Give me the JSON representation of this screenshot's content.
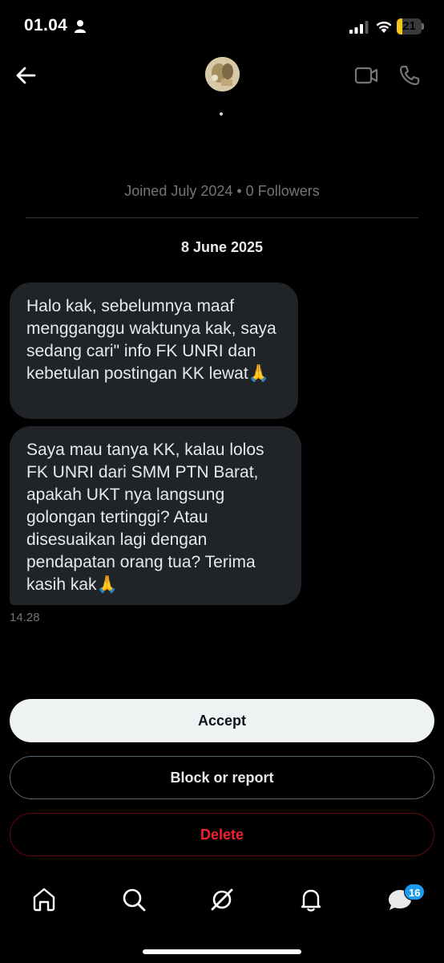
{
  "status_bar": {
    "time": "01.04",
    "battery_level": "21",
    "battery_fraction": 0.21
  },
  "header": {
    "back_icon": "arrow-left-icon",
    "avatar": "avatar",
    "video_icon": "video-camera-icon",
    "phone_icon": "phone-icon"
  },
  "profile": {
    "meta": "Joined July 2024 • 0 Followers"
  },
  "conversation": {
    "date": "8 June 2025",
    "messages": [
      {
        "text": "Halo kak, sebelumnya maaf mengganggu waktunya kak, saya sedang cari\" info FK UNRI dan kebetulan postingan KK lewat🙏"
      },
      {
        "text": "Saya mau tanya KK, kalau lolos FK UNRI dari SMM PTN Barat, apakah UKT nya langsung golongan tertinggi? Atau disesuaikan lagi dengan pendapatan orang tua? Terima kasih kak🙏"
      }
    ],
    "last_time": "14.28"
  },
  "actions": {
    "accept": "Accept",
    "block": "Block or report",
    "delete": "Delete"
  },
  "nav": {
    "items": [
      "home-icon",
      "search-icon",
      "grok-icon",
      "bell-icon",
      "messages-icon"
    ],
    "messages_badge": "16"
  },
  "colors": {
    "background": "#000000",
    "bubble": "#202327",
    "accent": "#1d9bf0",
    "danger": "#f4212e"
  }
}
